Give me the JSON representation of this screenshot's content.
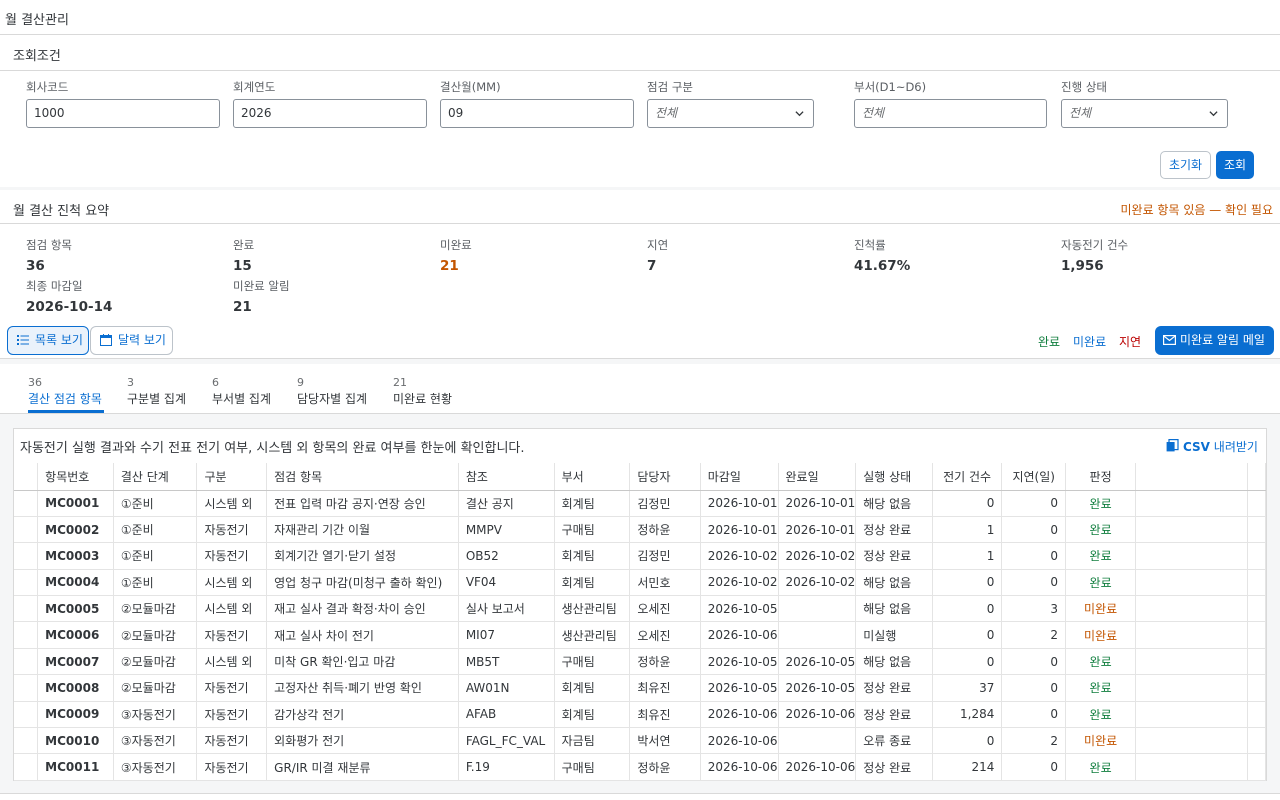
{
  "app_title": "월 결산관리",
  "filter": {
    "section_title": "조회조건",
    "fields": [
      {
        "label": "회사코드",
        "value": "1000",
        "placeholder": ""
      },
      {
        "label": "회계연도",
        "value": "2026",
        "placeholder": ""
      },
      {
        "label": "결산월(MM)",
        "value": "09",
        "placeholder": ""
      },
      {
        "label": "점검 구분",
        "value": "",
        "placeholder": "전체"
      },
      {
        "label": "부서(D1~D6)",
        "value": "",
        "placeholder": "전체"
      },
      {
        "label": "진행 상태",
        "value": "",
        "placeholder": "전체"
      }
    ],
    "reset_label": "초기화",
    "search_label": "조회"
  },
  "summary": {
    "title": "월 결산 진척 요약",
    "warning": "미완료 항목 있음 — 확인 필요",
    "kpis": [
      {
        "label": "점검 항목",
        "value": "36"
      },
      {
        "label": "완료",
        "value": "15"
      },
      {
        "label": "미완료",
        "value": "21"
      },
      {
        "label": "지연",
        "value": "7"
      },
      {
        "label": "진척률",
        "value": "41.67%"
      },
      {
        "label": "자동전기 건수",
        "value": "1,956"
      },
      {
        "label": "최종 마감일",
        "value": "2026-10-14"
      },
      {
        "label": "미완료 알림",
        "value": "21"
      }
    ]
  },
  "toolbar": {
    "list_view": "목록 보기",
    "calendar_view": "달력 보기",
    "legend_done": "완료",
    "legend_open": "미완료",
    "legend_delay": "지연",
    "mail_button": "미완료 알림 메일",
    "colors": {
      "done": "#107e3e",
      "open": "#0a6ed1",
      "delay": "#bb0000",
      "accent": "#0a6ed1",
      "warning": "#c35500"
    }
  },
  "tabs": [
    {
      "count": "36",
      "label": "결산 점검 항목"
    },
    {
      "count": "3",
      "label": "구분별 집계"
    },
    {
      "count": "6",
      "label": "부서별 집계"
    },
    {
      "count": "9",
      "label": "담당자별 집계"
    },
    {
      "count": "21",
      "label": "미완료 현황"
    }
  ],
  "table": {
    "description": "자동전기 실행 결과와 수기 전표 전기 여부, 시스템 외 항목의 완료 여부를 한눈에 확인합니다.",
    "csv_icon": "csv-file-icon",
    "csv_bold": "CSV",
    "csv_rest": " 내려받기",
    "columns": [
      "항목번호",
      "결산 단계",
      "구분",
      "점검 항목",
      "참조",
      "부서",
      "담당자",
      "마감일",
      "완료일",
      "실행 상태",
      "전기 건수",
      "지연(일)",
      "판정"
    ],
    "rows": [
      {
        "id": "MC0001",
        "stage": "①준비",
        "type": "시스템 외",
        "item": "전표 입력 마감 공지·연장 승인",
        "ref": "결산 공지",
        "dept": "회계팀",
        "owner": "김정민",
        "due": "2026-10-01",
        "done": "2026-10-01",
        "status": "해당 없음",
        "posts": "0",
        "delay": "0",
        "verdict": "완료"
      },
      {
        "id": "MC0002",
        "stage": "①준비",
        "type": "자동전기",
        "item": "자재관리 기간 이월",
        "ref": "MMPV",
        "dept": "구매팀",
        "owner": "정하윤",
        "due": "2026-10-01",
        "done": "2026-10-01",
        "status": "정상 완료",
        "posts": "1",
        "delay": "0",
        "verdict": "완료"
      },
      {
        "id": "MC0003",
        "stage": "①준비",
        "type": "자동전기",
        "item": "회계기간 열기·닫기 설정",
        "ref": "OB52",
        "dept": "회계팀",
        "owner": "김정민",
        "due": "2026-10-02",
        "done": "2026-10-02",
        "status": "정상 완료",
        "posts": "1",
        "delay": "0",
        "verdict": "완료"
      },
      {
        "id": "MC0004",
        "stage": "①준비",
        "type": "시스템 외",
        "item": "영업 청구 마감(미청구 출하 확인)",
        "ref": "VF04",
        "dept": "회계팀",
        "owner": "서민호",
        "due": "2026-10-02",
        "done": "2026-10-02",
        "status": "해당 없음",
        "posts": "0",
        "delay": "0",
        "verdict": "완료"
      },
      {
        "id": "MC0005",
        "stage": "②모듈마감",
        "type": "시스템 외",
        "item": "재고 실사 결과 확정·차이 승인",
        "ref": "실사 보고서",
        "dept": "생산관리팀",
        "owner": "오세진",
        "due": "2026-10-05",
        "done": "",
        "status": "해당 없음",
        "posts": "0",
        "delay": "3",
        "verdict": "미완료"
      },
      {
        "id": "MC0006",
        "stage": "②모듈마감",
        "type": "자동전기",
        "item": "재고 실사 차이 전기",
        "ref": "MI07",
        "dept": "생산관리팀",
        "owner": "오세진",
        "due": "2026-10-06",
        "done": "",
        "status": "미실행",
        "posts": "0",
        "delay": "2",
        "verdict": "미완료"
      },
      {
        "id": "MC0007",
        "stage": "②모듈마감",
        "type": "시스템 외",
        "item": "미착 GR 확인·입고 마감",
        "ref": "MB5T",
        "dept": "구매팀",
        "owner": "정하윤",
        "due": "2026-10-05",
        "done": "2026-10-05",
        "status": "해당 없음",
        "posts": "0",
        "delay": "0",
        "verdict": "완료"
      },
      {
        "id": "MC0008",
        "stage": "②모듈마감",
        "type": "자동전기",
        "item": "고정자산 취득·폐기 반영 확인",
        "ref": "AW01N",
        "dept": "회계팀",
        "owner": "최유진",
        "due": "2026-10-05",
        "done": "2026-10-05",
        "status": "정상 완료",
        "posts": "37",
        "delay": "0",
        "verdict": "완료"
      },
      {
        "id": "MC0009",
        "stage": "③자동전기",
        "type": "자동전기",
        "item": "감가상각 전기",
        "ref": "AFAB",
        "dept": "회계팀",
        "owner": "최유진",
        "due": "2026-10-06",
        "done": "2026-10-06",
        "status": "정상 완료",
        "posts": "1,284",
        "delay": "0",
        "verdict": "완료"
      },
      {
        "id": "MC0010",
        "stage": "③자동전기",
        "type": "자동전기",
        "item": "외화평가 전기",
        "ref": "FAGL_FC_VAL",
        "dept": "자금팀",
        "owner": "박서연",
        "due": "2026-10-06",
        "done": "",
        "status": "오류 종료",
        "posts": "0",
        "delay": "2",
        "verdict": "미완료"
      },
      {
        "id": "MC0011",
        "stage": "③자동전기",
        "type": "자동전기",
        "item": "GR/IR 미결 재분류",
        "ref": "F.19",
        "dept": "구매팀",
        "owner": "정하윤",
        "due": "2026-10-06",
        "done": "2026-10-06",
        "status": "정상 완료",
        "posts": "214",
        "delay": "0",
        "verdict": "완료"
      }
    ]
  }
}
